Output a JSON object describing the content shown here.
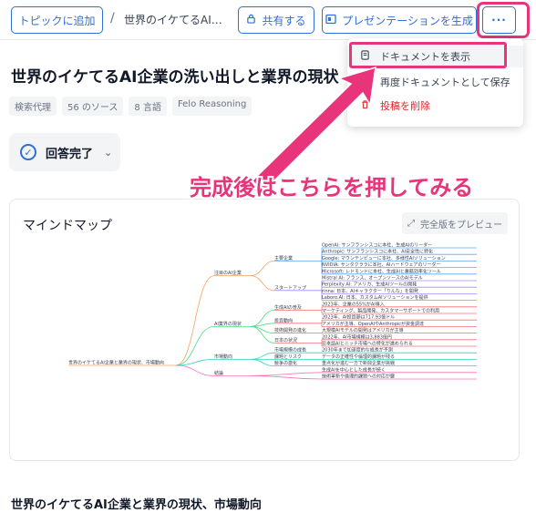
{
  "topbar": {
    "add_topic": "トピックに追加",
    "separator": "/",
    "breadcrumb_title": "世界のイケてるAI企業の洗い出しと業界の現状、市場動向",
    "share": "共有する",
    "presentation": "プレゼンテーションを生成",
    "more": "···"
  },
  "page": {
    "title": "世界のイケてるAI企業の洗い出しと業界の現状",
    "tags": [
      "検索代理",
      "56 のソース",
      "8 言語",
      "Felo Reasoning"
    ],
    "status": "回答完了"
  },
  "dropdown": {
    "items": [
      {
        "label": "ドキュメントを表示",
        "icon": "document-icon"
      },
      {
        "label": "再度ドキュメントとして保存",
        "icon": "pencil-icon"
      },
      {
        "label": "投稿を削除",
        "icon": "trash-icon"
      }
    ]
  },
  "annotation": "完成後はこちらを押してみる",
  "colors": {
    "accent": "#2f6fd6",
    "highlight": "#e8347a",
    "delete": "#dc2626"
  },
  "mindmap": {
    "title": "マインドマップ",
    "preview": "完全版をプレビュー",
    "root": "世界のイケてるAI企業と業界の現状、市場動向",
    "branches": [
      {
        "label": "注目のAI企業",
        "color": "#f4a261",
        "children": [
          {
            "label": "主要企業",
            "color": "#60a5fa",
            "items": [
              "OpenAI: サンフランシスコに本社、生成AIのリーダー",
              "Anthropic: サンフランシスコに本社、AI安全性に特化",
              "Google: マウンテンビューに本社、多様性AIソリューション",
              "NVIDIA: サンタクララに本社、AIハードウェアのリーダー",
              "Microsoft: レドモンドに本社、生成AIと業務効率化ツール"
            ]
          },
          {
            "label": "スタートアップ",
            "color": "#a78bfa",
            "items": [
              "Mistral AI: フランス、オープンソースのAIモデル",
              "Perplexity AI: アメリカ、生成AIツールの開発",
              "rinna: 日本、AIキャラクター「りんな」を開発",
              "Laboro.AI: 日本、カスタムAIソリューションを提供"
            ]
          }
        ]
      },
      {
        "label": "AI業界の現状",
        "color": "#4ade80",
        "children": [
          {
            "label": "生成AIの普及",
            "color": "#f87171",
            "items": [
              "2023年、企業の55%がAI導入",
              "マーケティング、製品開発、カスタマーサポートでの利用"
            ]
          },
          {
            "label": "投資動向",
            "color": "#f87171",
            "items": [
              "2023年、AI投資額は717.93億ドル",
              "アメリカが主導、OpenAIやAnthropicが資金調達"
            ]
          },
          {
            "label": "技術開発の進化",
            "color": "#f87171",
            "items": [
              "大規模AIモデルの開発はアメリカが主導"
            ]
          },
          {
            "label": "日本の状況",
            "color": "#f87171",
            "items": [
              "2022年、AI市場規模は3,883億円",
              "日本語AIとニッチ市場への特化が進められる"
            ]
          }
        ]
      },
      {
        "label": "市場動向",
        "color": "#2dd4bf",
        "children": [
          {
            "label": "市場規模の成長",
            "color": "#2dd4bf",
            "items": [
              "2030年まで加速度的な成長が予測"
            ]
          },
          {
            "label": "課題とリスク",
            "color": "#2dd4bf",
            "items": [
              "データの正確性や倫理的課題が残る"
            ]
          },
          {
            "label": "競争の激化",
            "color": "#2dd4bf",
            "items": [
              "重点化が進む一方で新興企業が挑戦"
            ]
          }
        ]
      },
      {
        "label": "結論",
        "color": "#f472b6",
        "children": [
          {
            "label": "",
            "color": "#f472b6",
            "items": [
              "生成AIを中心とした成長が続く",
              "技術革新や倫理的課題への対応が鍵"
            ]
          }
        ]
      }
    ]
  },
  "footer_title": "世界のイケてるAI企業と業界の現状、市場動向"
}
